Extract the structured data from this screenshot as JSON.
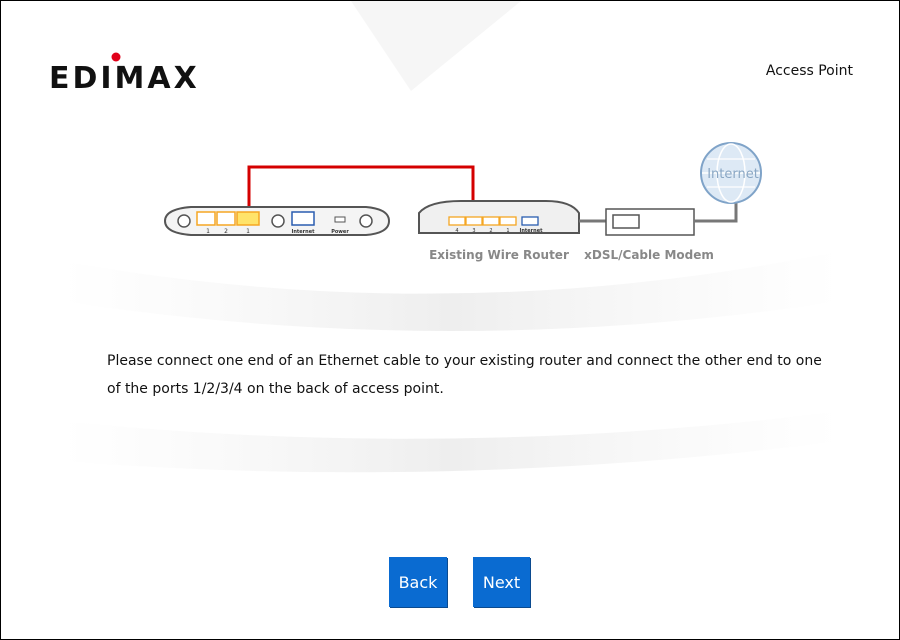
{
  "header": {
    "brand": "EDIMAX",
    "mode": "Access Point"
  },
  "diagram": {
    "ap_port_labels": [
      "1",
      "2",
      "1"
    ],
    "ap_internet_label": "Internet",
    "ap_power_label": "Power",
    "router_port_labels": [
      "4",
      "3",
      "2",
      "1"
    ],
    "router_internet_label": "Internet",
    "router_caption": "Existing Wire Router",
    "modem_caption": "xDSL/Cable Modem",
    "internet_label": "Internet",
    "colors": {
      "cable": "#d40000",
      "port": "#f5a623",
      "internet_port": "#2a5db0",
      "globe": "#8fb7e0"
    }
  },
  "main": {
    "instruction": "Please connect one end of an Ethernet cable to your existing router and connect the other end to one of the ports 1/2/3/4 on the back of access point."
  },
  "buttons": {
    "back": "Back",
    "next": "Next"
  }
}
